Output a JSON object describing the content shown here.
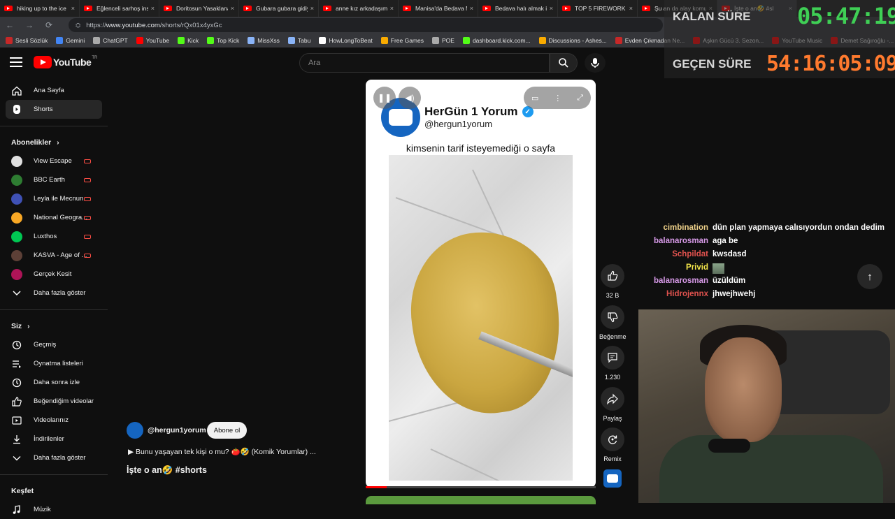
{
  "browser": {
    "tabs": [
      {
        "title": "hiking up to the ice"
      },
      {
        "title": "Eğlenceli sarhoş insa"
      },
      {
        "title": "Doritosun Yasaklanan"
      },
      {
        "title": "Gubara gubara gidiy"
      },
      {
        "title": "anne kız arkadaşım"
      },
      {
        "title": "Manisa'da Bedava M"
      },
      {
        "title": "Bedava halı almak is"
      },
      {
        "title": "TOP 5 FIREWORK D"
      },
      {
        "title": "Şu an da alay komu"
      },
      {
        "title": "İşte o an🤣 #sl"
      }
    ],
    "url_prefix": "https://",
    "url_host": "www.youtube.com",
    "url_path": "/shorts/rQx01x4yxGc",
    "bookmarks": [
      {
        "label": "Sesli Sözlük",
        "color": "#c62828"
      },
      {
        "label": "Gemini",
        "color": "#4285f4"
      },
      {
        "label": "ChatGPT",
        "color": "#aaaaaa"
      },
      {
        "label": "YouTube",
        "color": "#ff0000"
      },
      {
        "label": "Kick",
        "color": "#53fc18"
      },
      {
        "label": "Top Kick",
        "color": "#53fc18"
      },
      {
        "label": "MissXss",
        "color": "#8ab4f8"
      },
      {
        "label": "Tabu",
        "color": "#8ab4f8"
      },
      {
        "label": "HowLongToBeat",
        "color": "#ffffff"
      },
      {
        "label": "Free Games",
        "color": "#f9ab00"
      },
      {
        "label": "POE",
        "color": "#aaaaaa"
      },
      {
        "label": "dashboard.kick.com...",
        "color": "#53fc18"
      },
      {
        "label": "Discussions - Ashes...",
        "color": "#f9ab00"
      },
      {
        "label": "Evden Çıkmadan Ne...",
        "color": "#c62828"
      },
      {
        "label": "Aşkın Gücü 3. Sezon...",
        "color": "#ff0000"
      },
      {
        "label": "YouTube Music",
        "color": "#ff0000"
      },
      {
        "label": "Demet Sağıroğlu -...",
        "color": "#ff0000"
      }
    ]
  },
  "youtube": {
    "logo_text": "YouTube",
    "logo_region": "TR",
    "search_placeholder": "Ara",
    "sidebar": {
      "main": [
        {
          "label": "Ana Sayfa",
          "icon": "home-icon"
        },
        {
          "label": "Shorts",
          "icon": "shorts-icon"
        }
      ],
      "subscriptions_title": "Abonelikler",
      "subscriptions": [
        {
          "label": "View Escape",
          "color": "#e0e0e0",
          "live": true
        },
        {
          "label": "BBC Earth",
          "color": "#2e7d32",
          "live": true
        },
        {
          "label": "Leyla ile Mecnun",
          "color": "#3f51b5",
          "live": true
        },
        {
          "label": "National Geogra...",
          "color": "#f9a825",
          "live": true
        },
        {
          "label": "Luxthos",
          "color": "#00c853",
          "live": true
        },
        {
          "label": "KASVA - Age of ...",
          "color": "#5d4037",
          "live": true
        },
        {
          "label": "Gerçek Kesit",
          "color": "#ad1457",
          "live": false
        }
      ],
      "show_more": "Daha fazla göster",
      "you_title": "Siz",
      "you_items": [
        {
          "label": "Geçmiş",
          "icon": "history-icon"
        },
        {
          "label": "Oynatma listeleri",
          "icon": "playlist-icon"
        },
        {
          "label": "Daha sonra izle",
          "icon": "watch-later-icon"
        },
        {
          "label": "Beğendiğim videolar",
          "icon": "liked-icon"
        },
        {
          "label": "Videolarınız",
          "icon": "your-videos-icon"
        },
        {
          "label": "İndirilenler",
          "icon": "download-icon"
        },
        {
          "label": "Daha fazla göster",
          "icon": "chevron-down-icon"
        }
      ],
      "explore_title": "Keşfet",
      "explore_items": [
        {
          "label": "Müzik",
          "icon": "music-icon"
        }
      ]
    },
    "short": {
      "post_name": "HerGün 1 Yorum",
      "post_handle": "@hergun1yorum",
      "post_caption": "kimsenin tarif isteyemediği o sayfa",
      "progress": 0.09,
      "likes": "32 B",
      "dislike_label": "Beğenme",
      "comments": "1.230",
      "share_label": "Paylaş",
      "remix_label": "Remix",
      "channel_handle": "@hergun1yorum",
      "subscribe_label": "Abone ol",
      "description": "▶ Bunu yaşayan tek kişi o mu? 🍅🤣 (Komik Yorumlar) ...",
      "title": "İşte o an🤣 #shorts"
    }
  },
  "stream": {
    "remaining_label": "KALAN SÜRE",
    "remaining_value": "05:47:19",
    "elapsed_label": "GEÇEN SÜRE",
    "elapsed_value": "54:16:05:09",
    "chat": [
      {
        "user": "cimbination",
        "text": "dün plan yapmaya calısıyordun ondan dedim",
        "color": "#f0d28a"
      },
      {
        "user": "balanarosman",
        "text": "aga be",
        "color": "#d79ae8"
      },
      {
        "user": "Schpildat",
        "text": "kwsdasd",
        "color": "#e0524e"
      },
      {
        "user": "Privid",
        "text": "",
        "color": "#f7e84a"
      },
      {
        "user": "balanarosman",
        "text": "üzüldüm",
        "color": "#d79ae8"
      },
      {
        "user": "Hidrojennx",
        "text": "jhwejhwehj",
        "color": "#e0524e"
      }
    ]
  }
}
